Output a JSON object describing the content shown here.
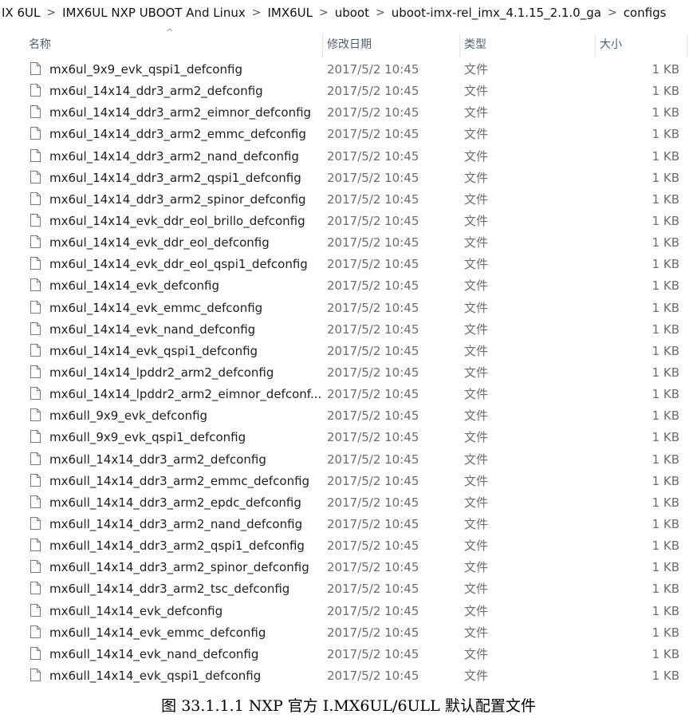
{
  "breadcrumb": {
    "items": [
      "IX 6UL",
      "IMX6UL NXP UBOOT And Linux",
      "IMX6UL",
      "uboot",
      "uboot-imx-rel_imx_4.1.15_2.1.0_ga",
      "configs"
    ],
    "separator": ">"
  },
  "columns": {
    "name": "名称",
    "date": "修改日期",
    "type": "类型",
    "size": "大小",
    "sort_indicator": "^"
  },
  "files": [
    {
      "name": "mx6ul_9x9_evk_qspi1_defconfig",
      "date": "2017/5/2 10:45",
      "type": "文件",
      "size": "1 KB"
    },
    {
      "name": "mx6ul_14x14_ddr3_arm2_defconfig",
      "date": "2017/5/2 10:45",
      "type": "文件",
      "size": "1 KB"
    },
    {
      "name": "mx6ul_14x14_ddr3_arm2_eimnor_defconfig",
      "date": "2017/5/2 10:45",
      "type": "文件",
      "size": "1 KB"
    },
    {
      "name": "mx6ul_14x14_ddr3_arm2_emmc_defconfig",
      "date": "2017/5/2 10:45",
      "type": "文件",
      "size": "1 KB"
    },
    {
      "name": "mx6ul_14x14_ddr3_arm2_nand_defconfig",
      "date": "2017/5/2 10:45",
      "type": "文件",
      "size": "1 KB"
    },
    {
      "name": "mx6ul_14x14_ddr3_arm2_qspi1_defconfig",
      "date": "2017/5/2 10:45",
      "type": "文件",
      "size": "1 KB"
    },
    {
      "name": "mx6ul_14x14_ddr3_arm2_spinor_defconfig",
      "date": "2017/5/2 10:45",
      "type": "文件",
      "size": "1 KB"
    },
    {
      "name": "mx6ul_14x14_evk_ddr_eol_brillo_defconfig",
      "date": "2017/5/2 10:45",
      "type": "文件",
      "size": "1 KB"
    },
    {
      "name": "mx6ul_14x14_evk_ddr_eol_defconfig",
      "date": "2017/5/2 10:45",
      "type": "文件",
      "size": "1 KB"
    },
    {
      "name": "mx6ul_14x14_evk_ddr_eol_qspi1_defconfig",
      "date": "2017/5/2 10:45",
      "type": "文件",
      "size": "1 KB"
    },
    {
      "name": "mx6ul_14x14_evk_defconfig",
      "date": "2017/5/2 10:45",
      "type": "文件",
      "size": "1 KB"
    },
    {
      "name": "mx6ul_14x14_evk_emmc_defconfig",
      "date": "2017/5/2 10:45",
      "type": "文件",
      "size": "1 KB"
    },
    {
      "name": "mx6ul_14x14_evk_nand_defconfig",
      "date": "2017/5/2 10:45",
      "type": "文件",
      "size": "1 KB"
    },
    {
      "name": "mx6ul_14x14_evk_qspi1_defconfig",
      "date": "2017/5/2 10:45",
      "type": "文件",
      "size": "1 KB"
    },
    {
      "name": "mx6ul_14x14_lpddr2_arm2_defconfig",
      "date": "2017/5/2 10:45",
      "type": "文件",
      "size": "1 KB"
    },
    {
      "name": "mx6ul_14x14_lpddr2_arm2_eimnor_defconf...",
      "date": "2017/5/2 10:45",
      "type": "文件",
      "size": "1 KB"
    },
    {
      "name": "mx6ull_9x9_evk_defconfig",
      "date": "2017/5/2 10:45",
      "type": "文件",
      "size": "1 KB"
    },
    {
      "name": "mx6ull_9x9_evk_qspi1_defconfig",
      "date": "2017/5/2 10:45",
      "type": "文件",
      "size": "1 KB"
    },
    {
      "name": "mx6ull_14x14_ddr3_arm2_defconfig",
      "date": "2017/5/2 10:45",
      "type": "文件",
      "size": "1 KB"
    },
    {
      "name": "mx6ull_14x14_ddr3_arm2_emmc_defconfig",
      "date": "2017/5/2 10:45",
      "type": "文件",
      "size": "1 KB"
    },
    {
      "name": "mx6ull_14x14_ddr3_arm2_epdc_defconfig",
      "date": "2017/5/2 10:45",
      "type": "文件",
      "size": "1 KB"
    },
    {
      "name": "mx6ull_14x14_ddr3_arm2_nand_defconfig",
      "date": "2017/5/2 10:45",
      "type": "文件",
      "size": "1 KB"
    },
    {
      "name": "mx6ull_14x14_ddr3_arm2_qspi1_defconfig",
      "date": "2017/5/2 10:45",
      "type": "文件",
      "size": "1 KB"
    },
    {
      "name": "mx6ull_14x14_ddr3_arm2_spinor_defconfig",
      "date": "2017/5/2 10:45",
      "type": "文件",
      "size": "1 KB"
    },
    {
      "name": "mx6ull_14x14_ddr3_arm2_tsc_defconfig",
      "date": "2017/5/2 10:45",
      "type": "文件",
      "size": "1 KB"
    },
    {
      "name": "mx6ull_14x14_evk_defconfig",
      "date": "2017/5/2 10:45",
      "type": "文件",
      "size": "1 KB"
    },
    {
      "name": "mx6ull_14x14_evk_emmc_defconfig",
      "date": "2017/5/2 10:45",
      "type": "文件",
      "size": "1 KB"
    },
    {
      "name": "mx6ull_14x14_evk_nand_defconfig",
      "date": "2017/5/2 10:45",
      "type": "文件",
      "size": "1 KB"
    },
    {
      "name": "mx6ull_14x14_evk_qspi1_defconfig",
      "date": "2017/5/2 10:45",
      "type": "文件",
      "size": "1 KB"
    }
  ],
  "file_icon": "file-icon",
  "caption": "图 33.1.1.1 NXP 官方 I.MX6UL/6ULL 默认配置文件"
}
